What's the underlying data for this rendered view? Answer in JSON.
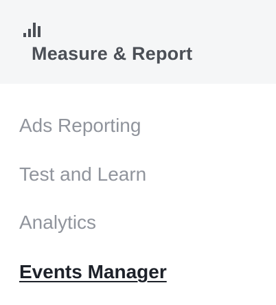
{
  "header": {
    "icon": "bar-chart-icon",
    "title": "Measure & Report",
    "background": "#f5f6f7",
    "text_color": "#4b4f56"
  },
  "menu": {
    "items": [
      {
        "label": "Ads Reporting",
        "active": false
      },
      {
        "label": "Test and Learn",
        "active": false
      },
      {
        "label": "Analytics",
        "active": false
      },
      {
        "label": "Events Manager",
        "active": true
      }
    ],
    "inactive_color": "#90949c",
    "active_color": "#1d2129"
  }
}
